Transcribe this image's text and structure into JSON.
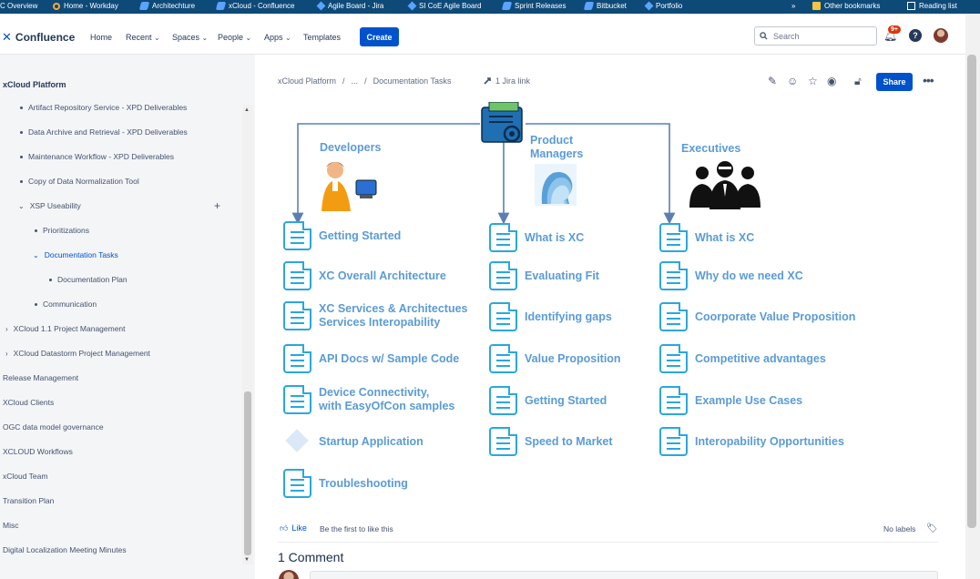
{
  "bookmarks": {
    "items": [
      {
        "label": "C Overview",
        "icon": "none"
      },
      {
        "label": "Home - Workday",
        "icon": "ring-icon"
      },
      {
        "label": "Architechture",
        "icon": "confluence-icon"
      },
      {
        "label": "xCloud - Confluence",
        "icon": "confluence-icon"
      },
      {
        "label": "Agile Board - Jira",
        "icon": "jira-icon"
      },
      {
        "label": "SI CoE Agile Board",
        "icon": "jira-icon"
      },
      {
        "label": "Sprint Releases",
        "icon": "confluence-icon"
      },
      {
        "label": "Bitbucket",
        "icon": "bitbucket-icon"
      },
      {
        "label": "Portfolio",
        "icon": "jira-icon"
      }
    ],
    "overflow": "»",
    "other": "Other bookmarks",
    "reading": "Reading list"
  },
  "nav": {
    "logo": "Confluence",
    "items": [
      "Home",
      "Recent",
      "Spaces",
      "People",
      "Apps",
      "Templates"
    ],
    "create": "Create",
    "search_placeholder": "Search",
    "badge": "9+",
    "help": "?"
  },
  "sidebar": {
    "title": "xCloud Platform",
    "items": [
      {
        "label": "Artifact Repository Service - XPD Deliverables"
      },
      {
        "label": "Data Archive and Retrieval - XPD Deliverables"
      },
      {
        "label": "Maintenance Workflow - XPD Deliverables"
      },
      {
        "label": "Copy of Data Normalization Tool"
      },
      {
        "label": "XSP Useability"
      },
      {
        "label": "Prioritizations"
      },
      {
        "label": "Documentation Tasks"
      },
      {
        "label": "Documentation Plan"
      },
      {
        "label": "Communication"
      },
      {
        "label": "XCloud 1.1 Project Management"
      },
      {
        "label": "XCloud Datastorm Project Management"
      },
      {
        "label": "Release Management"
      },
      {
        "label": "XCloud Clients"
      },
      {
        "label": "OGC data model governance"
      },
      {
        "label": "XCLOUD Workflows"
      },
      {
        "label": "xCloud Team"
      },
      {
        "label": "Transition Plan"
      },
      {
        "label": "Misc"
      },
      {
        "label": "Digital Localization Meeting Minutes"
      }
    ]
  },
  "breadcrumb": {
    "space": "xCloud Platform",
    "ellipsis": "...",
    "page": "Documentation Tasks",
    "sep": "/",
    "jira": "1 Jira link"
  },
  "page": {
    "share": "Share"
  },
  "diagram": {
    "columns": [
      {
        "heading": "Developers",
        "docs": [
          "Getting Started",
          "XC Overall Architecture",
          "XC Services & Architectues\nServices Interopability",
          "API Docs w/ Sample Code",
          "Device Connectivity,\nwith EasyOfCon samples",
          "Startup Application",
          "Troubleshooting"
        ]
      },
      {
        "heading": "Product\nManagers",
        "docs": [
          "What is XC",
          "Evaluating Fit",
          "Identifying gaps",
          "Value Proposition",
          "Getting Started",
          "Speed to Market"
        ]
      },
      {
        "heading": "Executives",
        "docs": [
          "What is XC",
          "Why do we need XC",
          "Coorporate Value Proposition",
          "Competitive advantages",
          "Example Use Cases",
          "Interopability Opportunities"
        ]
      }
    ],
    "colors": {
      "text": "#5b9bd5",
      "icon": "#29a7e0",
      "arrow": "#5b7fb5"
    }
  },
  "footer": {
    "like": "Like",
    "first_like": "Be the first to like this",
    "no_labels": "No labels",
    "comments": "1 Comment"
  }
}
